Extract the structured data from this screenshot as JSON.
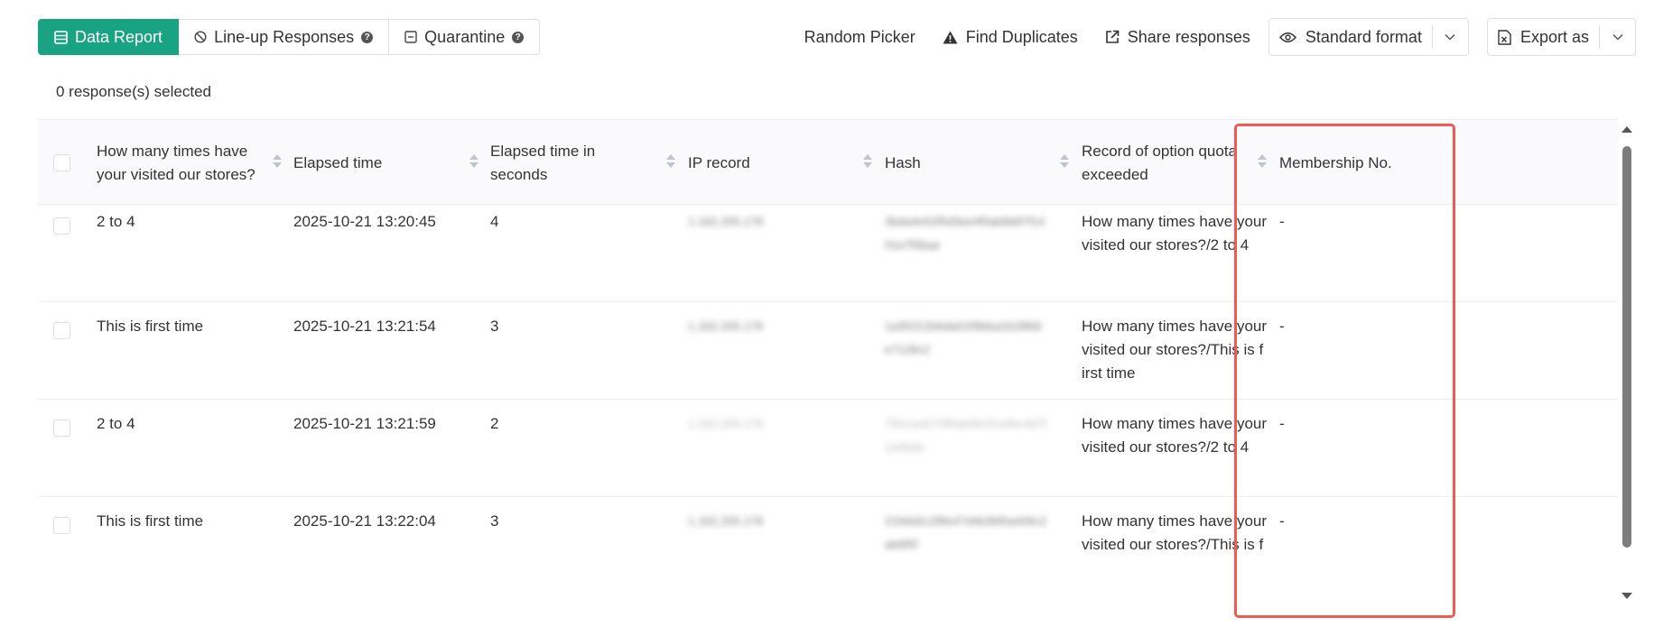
{
  "tabs": [
    {
      "label": "Data Report",
      "active": true,
      "icon": "table-icon"
    },
    {
      "label": "Line-up Responses",
      "active": false,
      "icon": "ban-icon"
    },
    {
      "label": "Quarantine",
      "active": false,
      "icon": "minus-box-icon"
    }
  ],
  "toolbar": {
    "random_picker": "Random Picker",
    "find_duplicates": "Find Duplicates",
    "share_responses": "Share responses",
    "format_select": "Standard format",
    "export": "Export as"
  },
  "selection": {
    "text": "0 response(s) selected"
  },
  "table": {
    "columns": [
      "How many times have your visited our stores?",
      "Elapsed time",
      "Elapsed time in seconds",
      "IP record",
      "Hash",
      "Record of option quota exceeded",
      "Membership No."
    ],
    "rows": [
      {
        "visits": "2 to 4",
        "elapsed": "2025-10-21 13:20:45",
        "seconds": "4",
        "ip": "1.162.205.178",
        "hash": "3bda4e52f5d3ee4f0ab6b87f1401e7f0bae",
        "quota_line1": "How many times have your",
        "quota_line2": "visited our stores?/2 to 4",
        "quota_line3": "",
        "membership": "-"
      },
      {
        "visits": "This is first time",
        "elapsed": "2025-10-21 13:21:54",
        "seconds": "3",
        "ip": "1.162.205.178",
        "hash": "1a3f1f12b6da01f9b6a2d1f869e7128c2",
        "quota_line1": "How many times have your",
        "quota_line2": "visited our stores?/This is f",
        "quota_line3": "irst time",
        "membership": "-"
      },
      {
        "visits": "2 to 4",
        "elapsed": "2025-10-21 13:21:59",
        "seconds": "2",
        "ip": "1.162.205.178",
        "hash": "7f3c1a4270f6ab6b1f1a4bc4d7f1a4bda",
        "quota_line1": "How many times have your",
        "quota_line2": "visited our stores?/2 to 4",
        "quota_line3": "",
        "membership": "-"
      },
      {
        "visits": "This is first time",
        "elapsed": "2025-10-21 13:22:04",
        "seconds": "3",
        "ip": "1.162.205.178",
        "hash": "21b6d2c2f8e47d4b3fd5a406c2ab6f5f",
        "quota_line1": "How many times have your",
        "quota_line2": "visited our stores?/This is f",
        "quota_line3": "",
        "membership": "-"
      }
    ]
  },
  "colors": {
    "accent": "#1aa382",
    "highlight": "#ef5b52"
  }
}
